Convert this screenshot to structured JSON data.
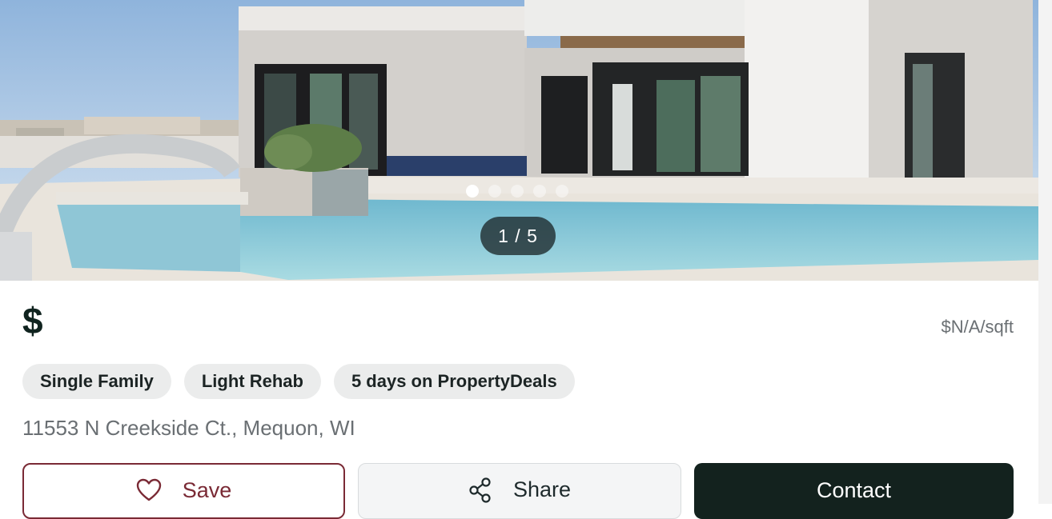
{
  "carousel": {
    "counter": "1 / 5",
    "total_slides": 5,
    "active_slide": 1
  },
  "listing": {
    "price": "$",
    "price_per_sqft": "$N/A/sqft",
    "tags": [
      "Single Family",
      "Light Rehab",
      "5 days on PropertyDeals"
    ],
    "address": "11553 N Creekside Ct., Mequon, WI"
  },
  "actions": {
    "save_label": "Save",
    "save_icon": "heart-icon",
    "share_label": "Share",
    "share_icon": "share-icon",
    "contact_label": "Contact"
  },
  "colors": {
    "save_accent": "#7a2a35",
    "contact_bg": "#13221e",
    "tag_bg": "#ebecec"
  }
}
